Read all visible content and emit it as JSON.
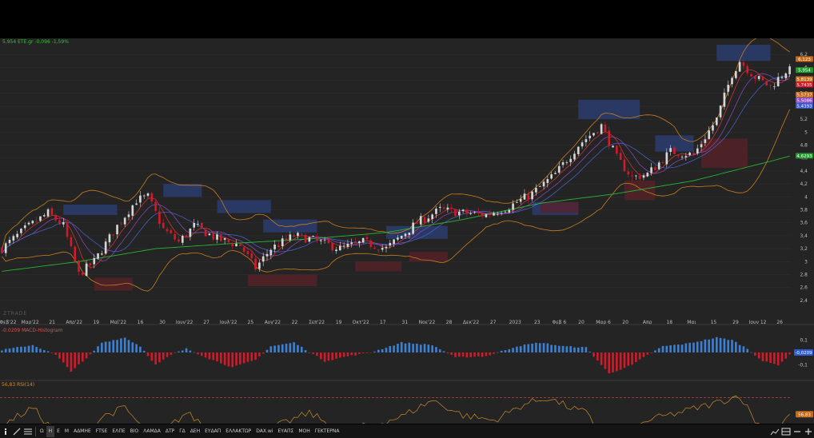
{
  "header": {
    "ticker_line": "5,954 ΕΤΕ.gr -0,096 -1,59%"
  },
  "watermark": "ZTRADE",
  "colors": {
    "up": "#d6d6d6",
    "down": "#d11a2a",
    "sma_long": "#27b533",
    "bollinger": "#c97d1e",
    "ma_red": "#e0353d",
    "ma_blue": "#4a66d6",
    "ma_purple": "#8e4cc4",
    "macd_pos": "#3d7fd1",
    "macd_neg": "#d11a2a",
    "rsi": "#c98a2a",
    "rsi_band": "#d44a4a"
  },
  "price_axis": {
    "ticks": [
      "6,2",
      "6",
      "5,8",
      "5,6",
      "5,4",
      "5,2",
      "5",
      "4,8",
      "4,6",
      "4,4",
      "4,2",
      "4",
      "3,8",
      "3,6",
      "3,4",
      "3,2",
      "3",
      "2,8",
      "2,6",
      "2,4"
    ],
    "badges": [
      {
        "label": "6,123",
        "value": 6.123,
        "color": "#c56a16"
      },
      {
        "label": "5,954",
        "value": 5.954,
        "color": "#1f9a2a"
      },
      {
        "label": "5,8139",
        "value": 5.8139,
        "color": "#c56a16"
      },
      {
        "label": "5,7435",
        "value": 5.7435,
        "color": "#d11a2a"
      },
      {
        "label": "5,5737",
        "value": 5.5737,
        "color": "#c56a16"
      },
      {
        "label": "5,5086",
        "value": 5.5086,
        "color": "#8e4cc4"
      },
      {
        "label": "5,4393",
        "value": 5.4393,
        "color": "#3858d0"
      },
      {
        "label": "4,6293",
        "value": 4.6293,
        "color": "#1f9a2a"
      }
    ]
  },
  "time_axis": {
    "labels": [
      "Φεβ'22",
      "Μαρ'22",
      "21",
      "Απρ'22",
      "19",
      "Μαϊ'22",
      "16",
      "30",
      "Ιουν'22",
      "27",
      "Ιουλ'22",
      "25",
      "Αυγ'22",
      "22",
      "Σεπ'22",
      "19",
      "Οκτ'22",
      "17",
      "31",
      "Νοε'22",
      "28",
      "Δεκ'22",
      "27",
      "2023",
      "23",
      "Φεβ 6",
      "20",
      "Μαρ 6",
      "20",
      "Απρ",
      "18",
      "Μαι",
      "15",
      "29",
      "Ιουν 12",
      "26"
    ]
  },
  "macd_panel": {
    "label": "-0,0209 MACD-Histogram",
    "badge": "-0,0209",
    "ticks": [
      "0,1",
      "-0,1"
    ]
  },
  "rsi_panel": {
    "label": "56,83 RSI(14)",
    "badge": "56,83"
  },
  "toolbar": {
    "items": [
      "Ω",
      "Η",
      "Ε",
      "Μ",
      "ΑΔΜΗΕ",
      "FTSE",
      "ΕΛΠΕ",
      "ΒΙΟ",
      "ΛΑΜΔΑ",
      "ΔΤΡ",
      "ΓΔ",
      "ΔΕΗ",
      "ΕΥΔΑΠ",
      "ΕΛΛΑΚΤΩΡ",
      "DAX.wi",
      "ΕΥΑΠΣ",
      "ΜΟΗ",
      "ΓΕΚΤΕΡΝΑ"
    ],
    "active_index": 1
  },
  "chart_data": {
    "type": "candlestick",
    "symbol": "ΕΤΕ.gr",
    "last": 5.954,
    "change": -0.096,
    "change_pct": -1.59,
    "ylim": [
      2.25,
      6.35
    ],
    "price_knots": [
      [
        0,
        3.2
      ],
      [
        6,
        3.5
      ],
      [
        12,
        3.75
      ],
      [
        16,
        3.55
      ],
      [
        20,
        2.8
      ],
      [
        24,
        3.0
      ],
      [
        30,
        3.55
      ],
      [
        35,
        3.95
      ],
      [
        38,
        4.0
      ],
      [
        42,
        3.5
      ],
      [
        46,
        3.3
      ],
      [
        50,
        3.55
      ],
      [
        56,
        3.35
      ],
      [
        62,
        3.25
      ],
      [
        66,
        2.9
      ],
      [
        70,
        3.2
      ],
      [
        76,
        3.4
      ],
      [
        80,
        3.35
      ],
      [
        88,
        3.2
      ],
      [
        94,
        3.3
      ],
      [
        100,
        3.2
      ],
      [
        108,
        3.6
      ],
      [
        114,
        3.8
      ],
      [
        120,
        3.75
      ],
      [
        126,
        3.72
      ],
      [
        132,
        3.85
      ],
      [
        138,
        4.05
      ],
      [
        144,
        4.35
      ],
      [
        150,
        4.8
      ],
      [
        156,
        5.1
      ],
      [
        160,
        4.6
      ],
      [
        164,
        4.3
      ],
      [
        168,
        4.35
      ],
      [
        174,
        4.7
      ],
      [
        180,
        4.65
      ],
      [
        186,
        5.2
      ],
      [
        190,
        5.9
      ],
      [
        192,
        6.1
      ],
      [
        196,
        5.85
      ],
      [
        200,
        5.7
      ],
      [
        204,
        5.95
      ]
    ],
    "sma_long_knots": [
      [
        0,
        2.85
      ],
      [
        20,
        3.0
      ],
      [
        40,
        3.2
      ],
      [
        60,
        3.28
      ],
      [
        80,
        3.35
      ],
      [
        100,
        3.45
      ],
      [
        120,
        3.65
      ],
      [
        140,
        3.9
      ],
      [
        160,
        4.05
      ],
      [
        180,
        4.25
      ],
      [
        200,
        4.55
      ],
      [
        205,
        4.63
      ]
    ],
    "macd_knots": [
      [
        0,
        0.02
      ],
      [
        8,
        0.06
      ],
      [
        14,
        -0.02
      ],
      [
        18,
        -0.15
      ],
      [
        22,
        -0.05
      ],
      [
        26,
        0.08
      ],
      [
        32,
        0.12
      ],
      [
        36,
        0.05
      ],
      [
        40,
        -0.1
      ],
      [
        44,
        -0.02
      ],
      [
        48,
        0.03
      ],
      [
        54,
        -0.05
      ],
      [
        60,
        -0.12
      ],
      [
        66,
        -0.06
      ],
      [
        70,
        0.05
      ],
      [
        76,
        0.08
      ],
      [
        84,
        -0.07
      ],
      [
        90,
        -0.03
      ],
      [
        96,
        0.0
      ],
      [
        104,
        0.08
      ],
      [
        112,
        0.06
      ],
      [
        118,
        -0.04
      ],
      [
        126,
        -0.03
      ],
      [
        134,
        0.05
      ],
      [
        140,
        0.08
      ],
      [
        146,
        0.05
      ],
      [
        152,
        0.04
      ],
      [
        158,
        -0.17
      ],
      [
        164,
        -0.1
      ],
      [
        168,
        -0.02
      ],
      [
        172,
        0.05
      ],
      [
        178,
        0.07
      ],
      [
        186,
        0.12
      ],
      [
        190,
        0.1
      ],
      [
        194,
        0.03
      ],
      [
        198,
        -0.07
      ],
      [
        202,
        -0.1
      ],
      [
        205,
        -0.02
      ]
    ],
    "macd_ylim": [
      -0.2,
      0.2
    ],
    "rsi_knots": [
      [
        0,
        48
      ],
      [
        8,
        62
      ],
      [
        16,
        35
      ],
      [
        20,
        28
      ],
      [
        26,
        55
      ],
      [
        32,
        62
      ],
      [
        36,
        48
      ],
      [
        40,
        38
      ],
      [
        48,
        58
      ],
      [
        54,
        45
      ],
      [
        60,
        40
      ],
      [
        64,
        28
      ],
      [
        72,
        48
      ],
      [
        80,
        58
      ],
      [
        88,
        44
      ],
      [
        96,
        48
      ],
      [
        104,
        55
      ],
      [
        112,
        68
      ],
      [
        120,
        56
      ],
      [
        128,
        52
      ],
      [
        136,
        65
      ],
      [
        142,
        70
      ],
      [
        148,
        62
      ],
      [
        152,
        58
      ],
      [
        158,
        30
      ],
      [
        162,
        40
      ],
      [
        168,
        52
      ],
      [
        176,
        58
      ],
      [
        186,
        66
      ],
      [
        192,
        72
      ],
      [
        196,
        52
      ],
      [
        200,
        40
      ],
      [
        205,
        56.83
      ]
    ],
    "rsi_ylim": [
      20,
      80
    ],
    "rsi_bands": [
      30,
      70
    ],
    "bars": 206
  }
}
